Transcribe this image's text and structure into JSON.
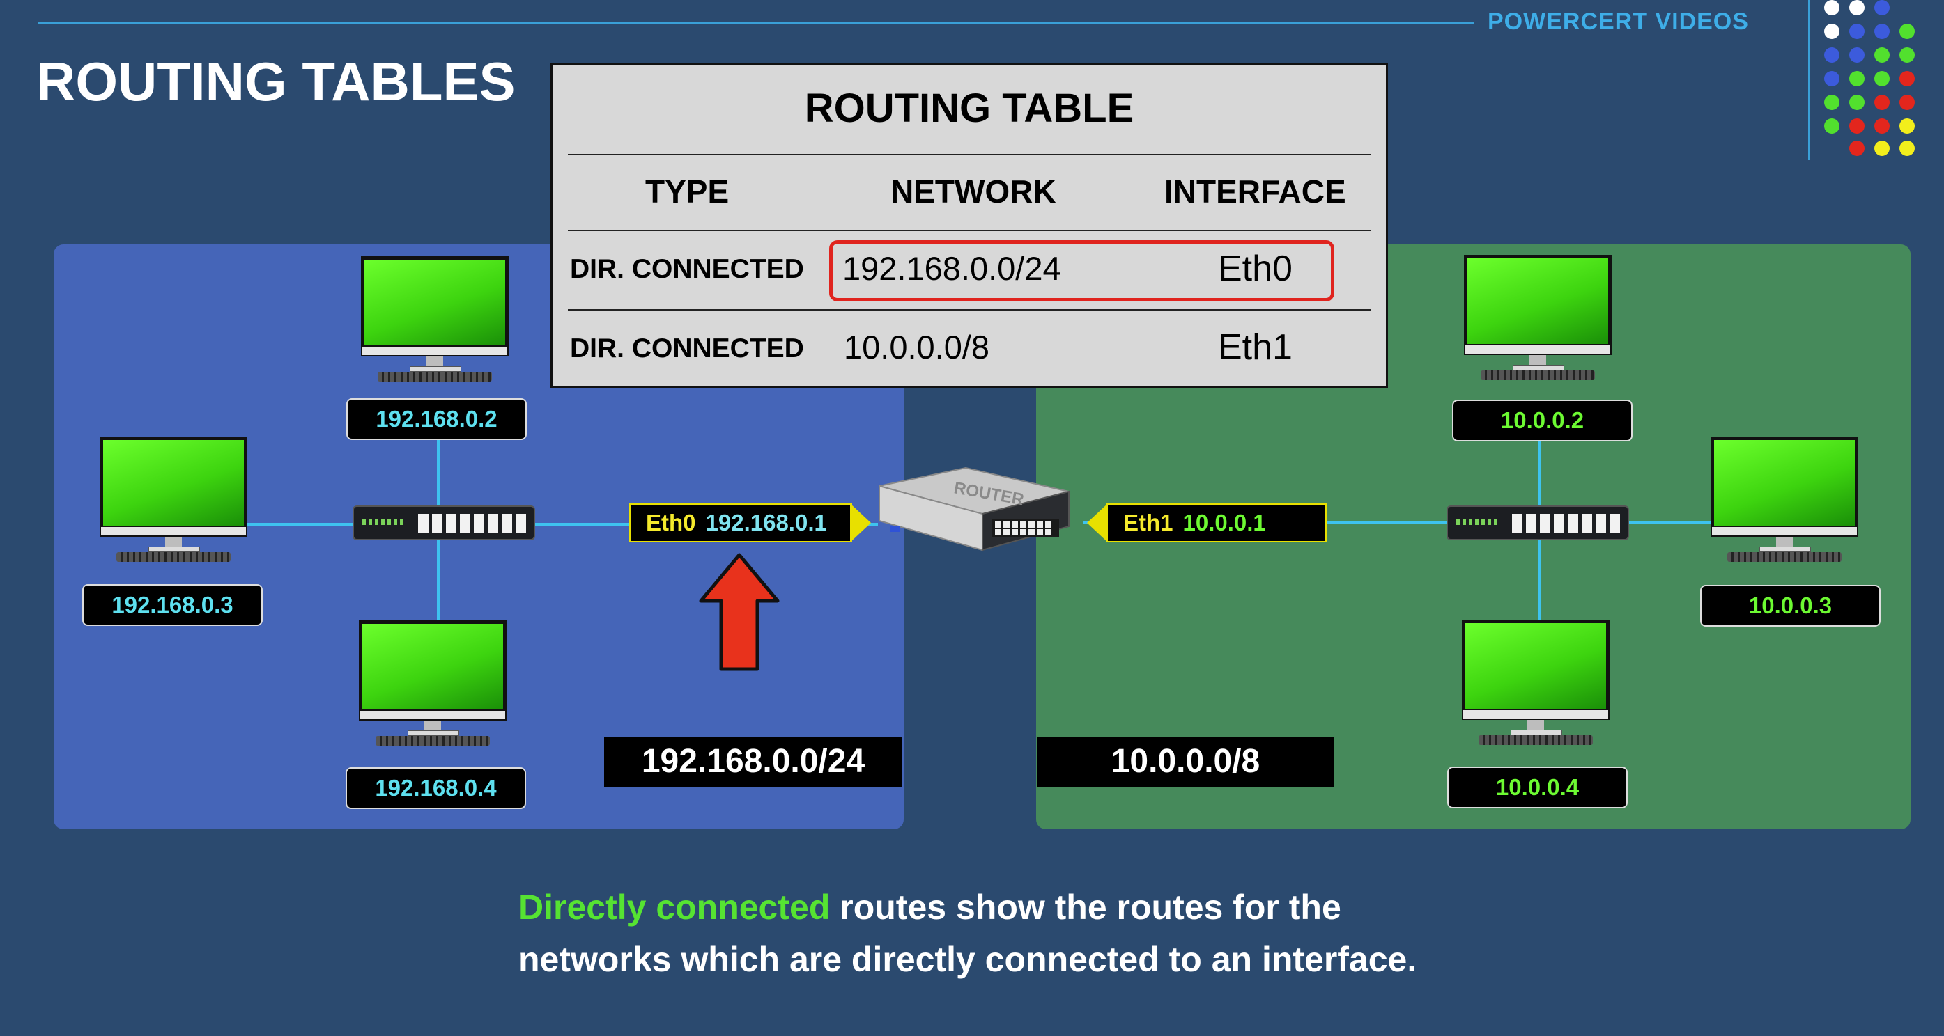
{
  "brand": "POWERCERT VIDEOS",
  "title": "ROUTING TABLES",
  "routing_table": {
    "title": "ROUTING TABLE",
    "headers": [
      "TYPE",
      "NETWORK",
      "INTERFACE"
    ],
    "rows": [
      {
        "type": "DIR. CONNECTED",
        "network": "192.168.0.0/24",
        "interface": "Eth0",
        "highlighted": true
      },
      {
        "type": "DIR. CONNECTED",
        "network": "10.0.0.0/8",
        "interface": "Eth1",
        "highlighted": false
      }
    ]
  },
  "left_network": {
    "network": "192.168.0.0/24",
    "hosts": [
      "192.168.0.2",
      "192.168.0.3",
      "192.168.0.4"
    ],
    "interface": {
      "name": "Eth0",
      "address": "192.168.0.1"
    }
  },
  "right_network": {
    "network": "10.0.0.0/8",
    "hosts": [
      "10.0.0.2",
      "10.0.0.3",
      "10.0.0.4"
    ],
    "interface": {
      "name": "Eth1",
      "address": "10.0.0.1"
    }
  },
  "router": {
    "label": "ROUTER"
  },
  "caption": {
    "highlight": "Directly connected",
    "line1_rest": " routes show the routes for the",
    "line2": "networks which are directly connected to an interface."
  },
  "colors": {
    "background": "#2b4a6f",
    "left_panel": "#4565b8",
    "right_panel": "#468a5b",
    "highlight_box": "#e0241e",
    "arrow": "#e8321c",
    "accent_green": "#56e332",
    "interface_yellow": "#f5ea2c"
  }
}
